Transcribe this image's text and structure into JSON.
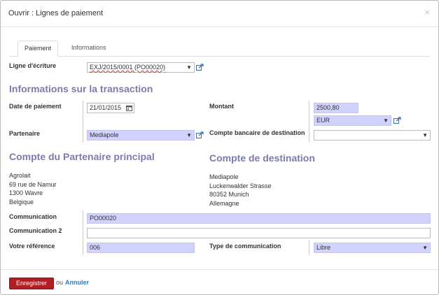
{
  "dialog": {
    "title": "Ouvrir : Lignes de paiement",
    "close": "×"
  },
  "tabs": [
    {
      "label": "Paiement"
    },
    {
      "label": "Informations"
    }
  ],
  "ligne": {
    "label": "Ligne d'écriture",
    "value": "EXJ/2015/0001 (PO00020)"
  },
  "transaction": {
    "title": "Informations sur la transaction",
    "date_label": "Date de paiement",
    "date_value": "21/01/2015",
    "montant_label": "Montant",
    "montant_value": "2500,80",
    "currency": "EUR",
    "partenaire_label": "Partenaire",
    "partenaire_value": "Mediapole",
    "compte_label": "Compte bancaire de destination",
    "compte_value": ""
  },
  "partner_account": {
    "title": "Compte du Partenaire principal",
    "lines": [
      "Agrolait",
      "69 rue de Namur",
      "1300 Wavre",
      "Belgique"
    ]
  },
  "dest_account": {
    "title": "Compte de destination",
    "lines": [
      "Mediapole",
      "Luckenwalder Strasse",
      "80352 Munich",
      "Allemagne"
    ]
  },
  "communication": {
    "label": "Communication",
    "value": "PO00020"
  },
  "communication2": {
    "label": "Communication 2",
    "value": ""
  },
  "reference": {
    "label": "Votre référence",
    "value": "006"
  },
  "comm_type": {
    "label": "Type de communication",
    "value": "Libre"
  },
  "footer": {
    "save": "Enregistrer",
    "or": "ou",
    "cancel": "Annuler"
  },
  "colors": {
    "section": "#7c7bad",
    "required": "#d2d2ff",
    "save": "#b01f24",
    "link": "#2f7ab9"
  }
}
